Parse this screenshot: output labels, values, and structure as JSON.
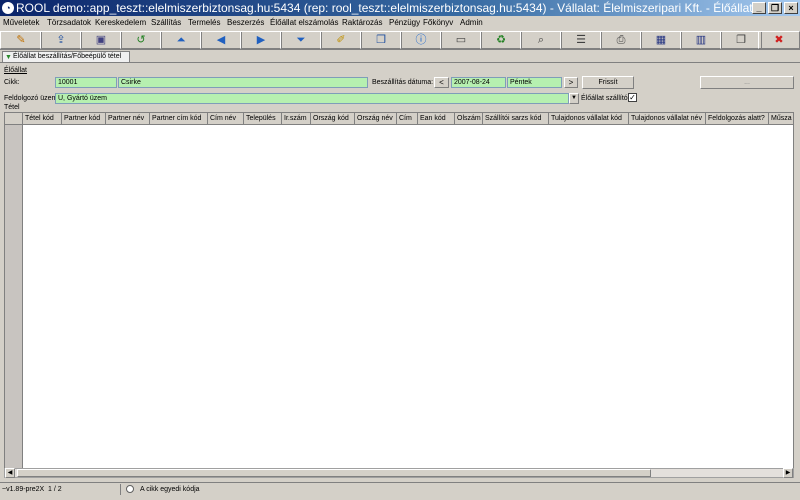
{
  "window": {
    "title": "ROOL demo::app_teszt::elelmiszerbiztonsag.hu:5434 (rep: rool_teszt::elelmiszerbiztonsag.hu:5434) - Vállalat: Élelmiszeripari Kft. - Élőállat be..."
  },
  "menu": [
    "Műveletek",
    "Törzsadatok",
    "Kereskedelem",
    "Szállítás",
    "Termelés",
    "Beszerzés",
    "Élőállat elszámolás",
    "Raktározás",
    "Pénzügy",
    "Főkönyv",
    "Admin"
  ],
  "toolbar": {
    "icons": [
      "edit-icon",
      "export-icon",
      "save-icon",
      "refresh-icon",
      "first-icon",
      "prev-icon",
      "next-icon",
      "last-icon",
      "note-icon",
      "document-icon",
      "info-icon",
      "form-icon",
      "reload-icon",
      "search-icon",
      "list-icon",
      "print-icon",
      "grid-icon",
      "grid-alt-icon",
      "window-icon",
      "close-icon"
    ],
    "glyphs": [
      "✎",
      "⇪",
      "▣",
      "↺",
      "⏶",
      "◀",
      "▶",
      "⏷",
      "✐",
      "❒",
      "ⓘ",
      "▭",
      "♻",
      "⌕",
      "☰",
      "⎙",
      "▦",
      "▥",
      "❐",
      "✖"
    ]
  },
  "tab": {
    "label": "Élőállat beszállítás/Főbeépülő tétel"
  },
  "form": {
    "section_animal": "Élőállat",
    "cikk_label": "Cikk:",
    "cikk_code": "10001",
    "cikk_name": "Csirke",
    "delivery_date_label": "Beszállítás dátuma:",
    "prev": "<",
    "date": "2007-08-24",
    "day": "Péntek",
    "next": ">",
    "refresh": "Frissít",
    "extra_button": "...",
    "plant_label": "Feldolgozó üzem:",
    "plant_value": "U, Gyártó üzem",
    "live_delivery_label": "Élőállat szállító?",
    "section_item": "Tétel"
  },
  "grid": {
    "columns": [
      "Tétel kód",
      "Partner kód",
      "Partner név",
      "Partner cím kód",
      "Cím név",
      "Település",
      "Ir.szám",
      "Ország kód",
      "Ország név",
      "Cím",
      "Ean kód",
      "Olszám",
      "Szállítói sarzs kód",
      "Tulajdonos vállalat kód",
      "Tulajdonos vállalat név",
      "Feldolgozás alatt?",
      "Műsza"
    ]
  },
  "status": {
    "version": "~v1.89-pre2X",
    "page": "1 / 2",
    "hint": "A cikk egyedi kódja"
  }
}
